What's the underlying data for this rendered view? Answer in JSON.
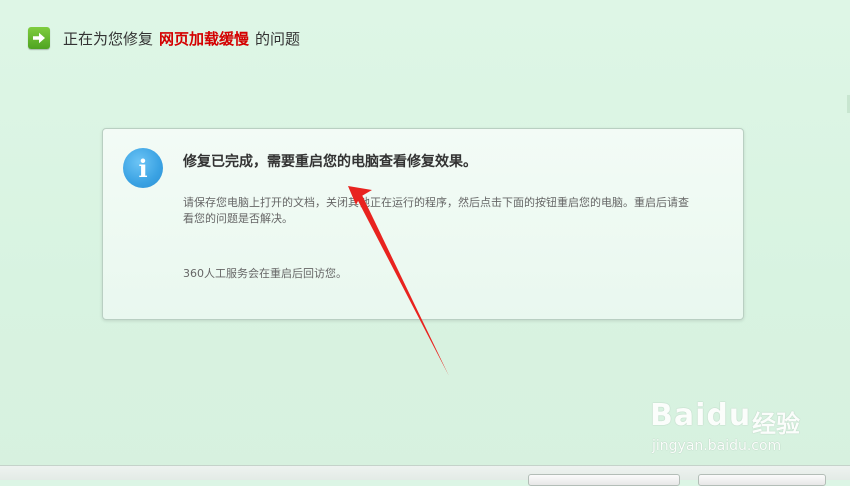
{
  "header": {
    "prefix": "正在为您修复",
    "highlight": "网页加载缓慢",
    "suffix": "的问题",
    "icon": "arrow-right-icon",
    "highlight_color": "#d40000"
  },
  "dialog": {
    "icon": "info-icon",
    "icon_glyph": "i",
    "title": "修复已完成，需要重启您的电脑查看修复效果。",
    "body": "请保存您电脑上打开的文档，关闭其他正在运行的程序，然后点击下面的按钮重启您的电脑。重启后请查看您的问题是否解决。",
    "note": "360人工服务会在重启后回访您。"
  },
  "watermark": {
    "brand": "Baidu",
    "cn": "经验",
    "url": "jingyan.baidu.com"
  },
  "colors": {
    "background": "#dcf5e5",
    "annotation_arrow": "#e8231f",
    "info_icon": "#3aa2e3"
  }
}
